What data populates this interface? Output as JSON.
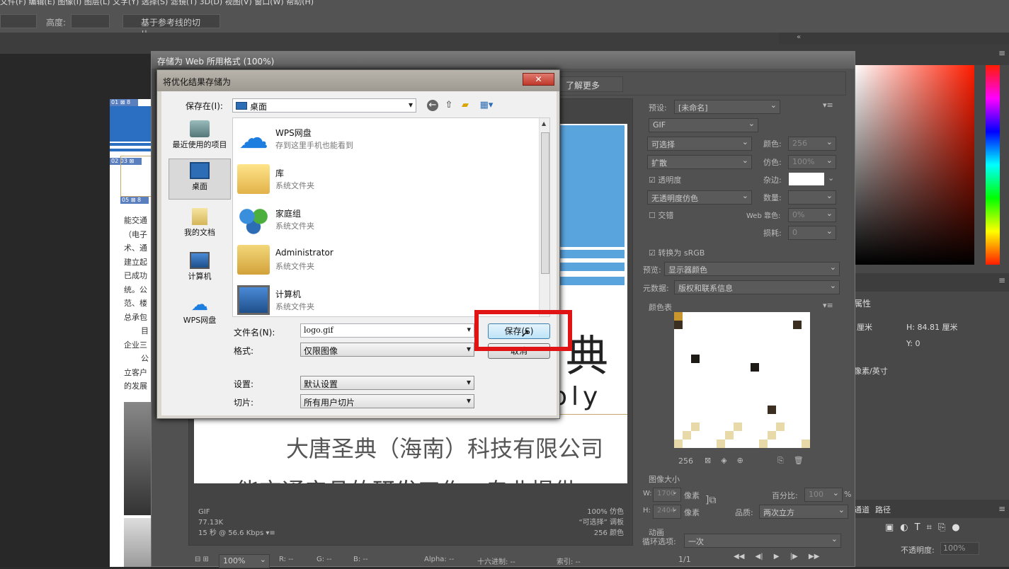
{
  "ps": {
    "menu_text": "文件(F)  编辑(E)  图像(I)  图层(L)  文字(Y)  选择(S)  滤镜(T)  3D(D)  视图(V)  窗口(W)  帮助(H)",
    "height_label": "高度:",
    "slice_from_guides": "基于参考线的切片",
    "props_title": "属性",
    "unit_cm": "厘米",
    "h_label": "H: 84.81 厘米",
    "y_label": "Y: 0",
    "res_unit": "像素/英寸",
    "paths_tab": "路径",
    "channels_tab": "通道",
    "opacity_label": "不透明度:",
    "opacity_value": "100%",
    "left_doc_lines": [
      "能交通",
      "（电子",
      "术、通",
      "建立起",
      "已成功",
      "统。公",
      "范、楼",
      "总承包",
      "目",
      "企业三",
      "公",
      "立客户",
      "的发展"
    ],
    "slice_tags": [
      "01 ⊠ 8",
      "02 03 ⊠",
      "05 ⊠ 8"
    ]
  },
  "sfw": {
    "title": "存储为 Web 所用格式 (100%)",
    "learn_more": "了解更多",
    "preset_label": "预设:",
    "preset_value": "[未命名]",
    "format": "GIF",
    "reduction": "可选择",
    "dither_algo": "扩散",
    "transparency": "透明度",
    "transparency_dither": "无透明度仿色",
    "interlaced": "交错",
    "colors_label": "颜色:",
    "colors_value": "256",
    "dither_label": "仿色:",
    "dither_value": "100%",
    "matte_label": "杂边:",
    "amount_label": "数量:",
    "web_snap_label": "Web 靠色:",
    "web_snap_value": "0%",
    "lossy_label": "损耗:",
    "lossy_value": "0",
    "convert_srgb": "转换为 sRGB",
    "preview_label": "预览:",
    "preview_value": "显示器颜色",
    "metadata_label": "元数据:",
    "metadata_value": "版权和联系信息",
    "color_table_label": "颜色表",
    "color_count": "256",
    "image_size_label": "图像大小",
    "w_label": "W:",
    "w_value": "1700",
    "h_label": "H:",
    "h_value": "2404",
    "px": "像素",
    "percent_label": "百分比:",
    "percent_value": "100",
    "percent_unit": "%",
    "quality_label": "品质:",
    "quality_value": "两次立方",
    "animation_label": "动画",
    "loop_label": "循环选项:",
    "loop_value": "一次",
    "frame_counter": "1/1",
    "info_format": "GIF",
    "info_size": "77.13K",
    "info_time": "15 秒 @ 56.6 Kbps",
    "info_dither": "100% 仿色",
    "info_palette": "“可选择” 调板",
    "info_colors": "256 颜色",
    "zoom": "100%",
    "r_label": "R: --",
    "g_label": "G: --",
    "b_label": "B: --",
    "alpha_label": "Alpha: --",
    "hex_label": "十六进制: --",
    "index_label": "索引: --",
    "preview_char": "典",
    "preview_en": "oly",
    "preview_cn1": "大唐圣典（海南）科技有限公司",
    "preview_cn2": "能交通产品的研发工作，专业提供"
  },
  "dialog": {
    "title": "将优化结果存储为",
    "close": "✕",
    "save_in_label": "保存在(I):",
    "save_in_value": "桌面",
    "places": [
      {
        "label": "最近使用的项目"
      },
      {
        "label": "桌面"
      },
      {
        "label": "我的文档"
      },
      {
        "label": "计算机"
      },
      {
        "label": "WPS网盘"
      }
    ],
    "files": [
      {
        "name": "WPS网盘",
        "sub": "存到这里手机也能看到"
      },
      {
        "name": "库",
        "sub": "系统文件夹"
      },
      {
        "name": "家庭组",
        "sub": "系统文件夹"
      },
      {
        "name": "Administrator",
        "sub": "系统文件夹"
      },
      {
        "name": "计算机",
        "sub": "系统文件夹"
      }
    ],
    "filename_label": "文件名(N):",
    "filename_value": "logo.gif",
    "format_label": "格式:",
    "format_value": "仅限图像",
    "settings_label": "设置:",
    "settings_value": "默认设置",
    "slices_label": "切片:",
    "slices_value": "所有用户切片",
    "save_button": "保存(S)",
    "cancel_button": "取消"
  },
  "colors": {
    "accent_red": "#e01414",
    "preview_blue": "#5aa4dd"
  }
}
